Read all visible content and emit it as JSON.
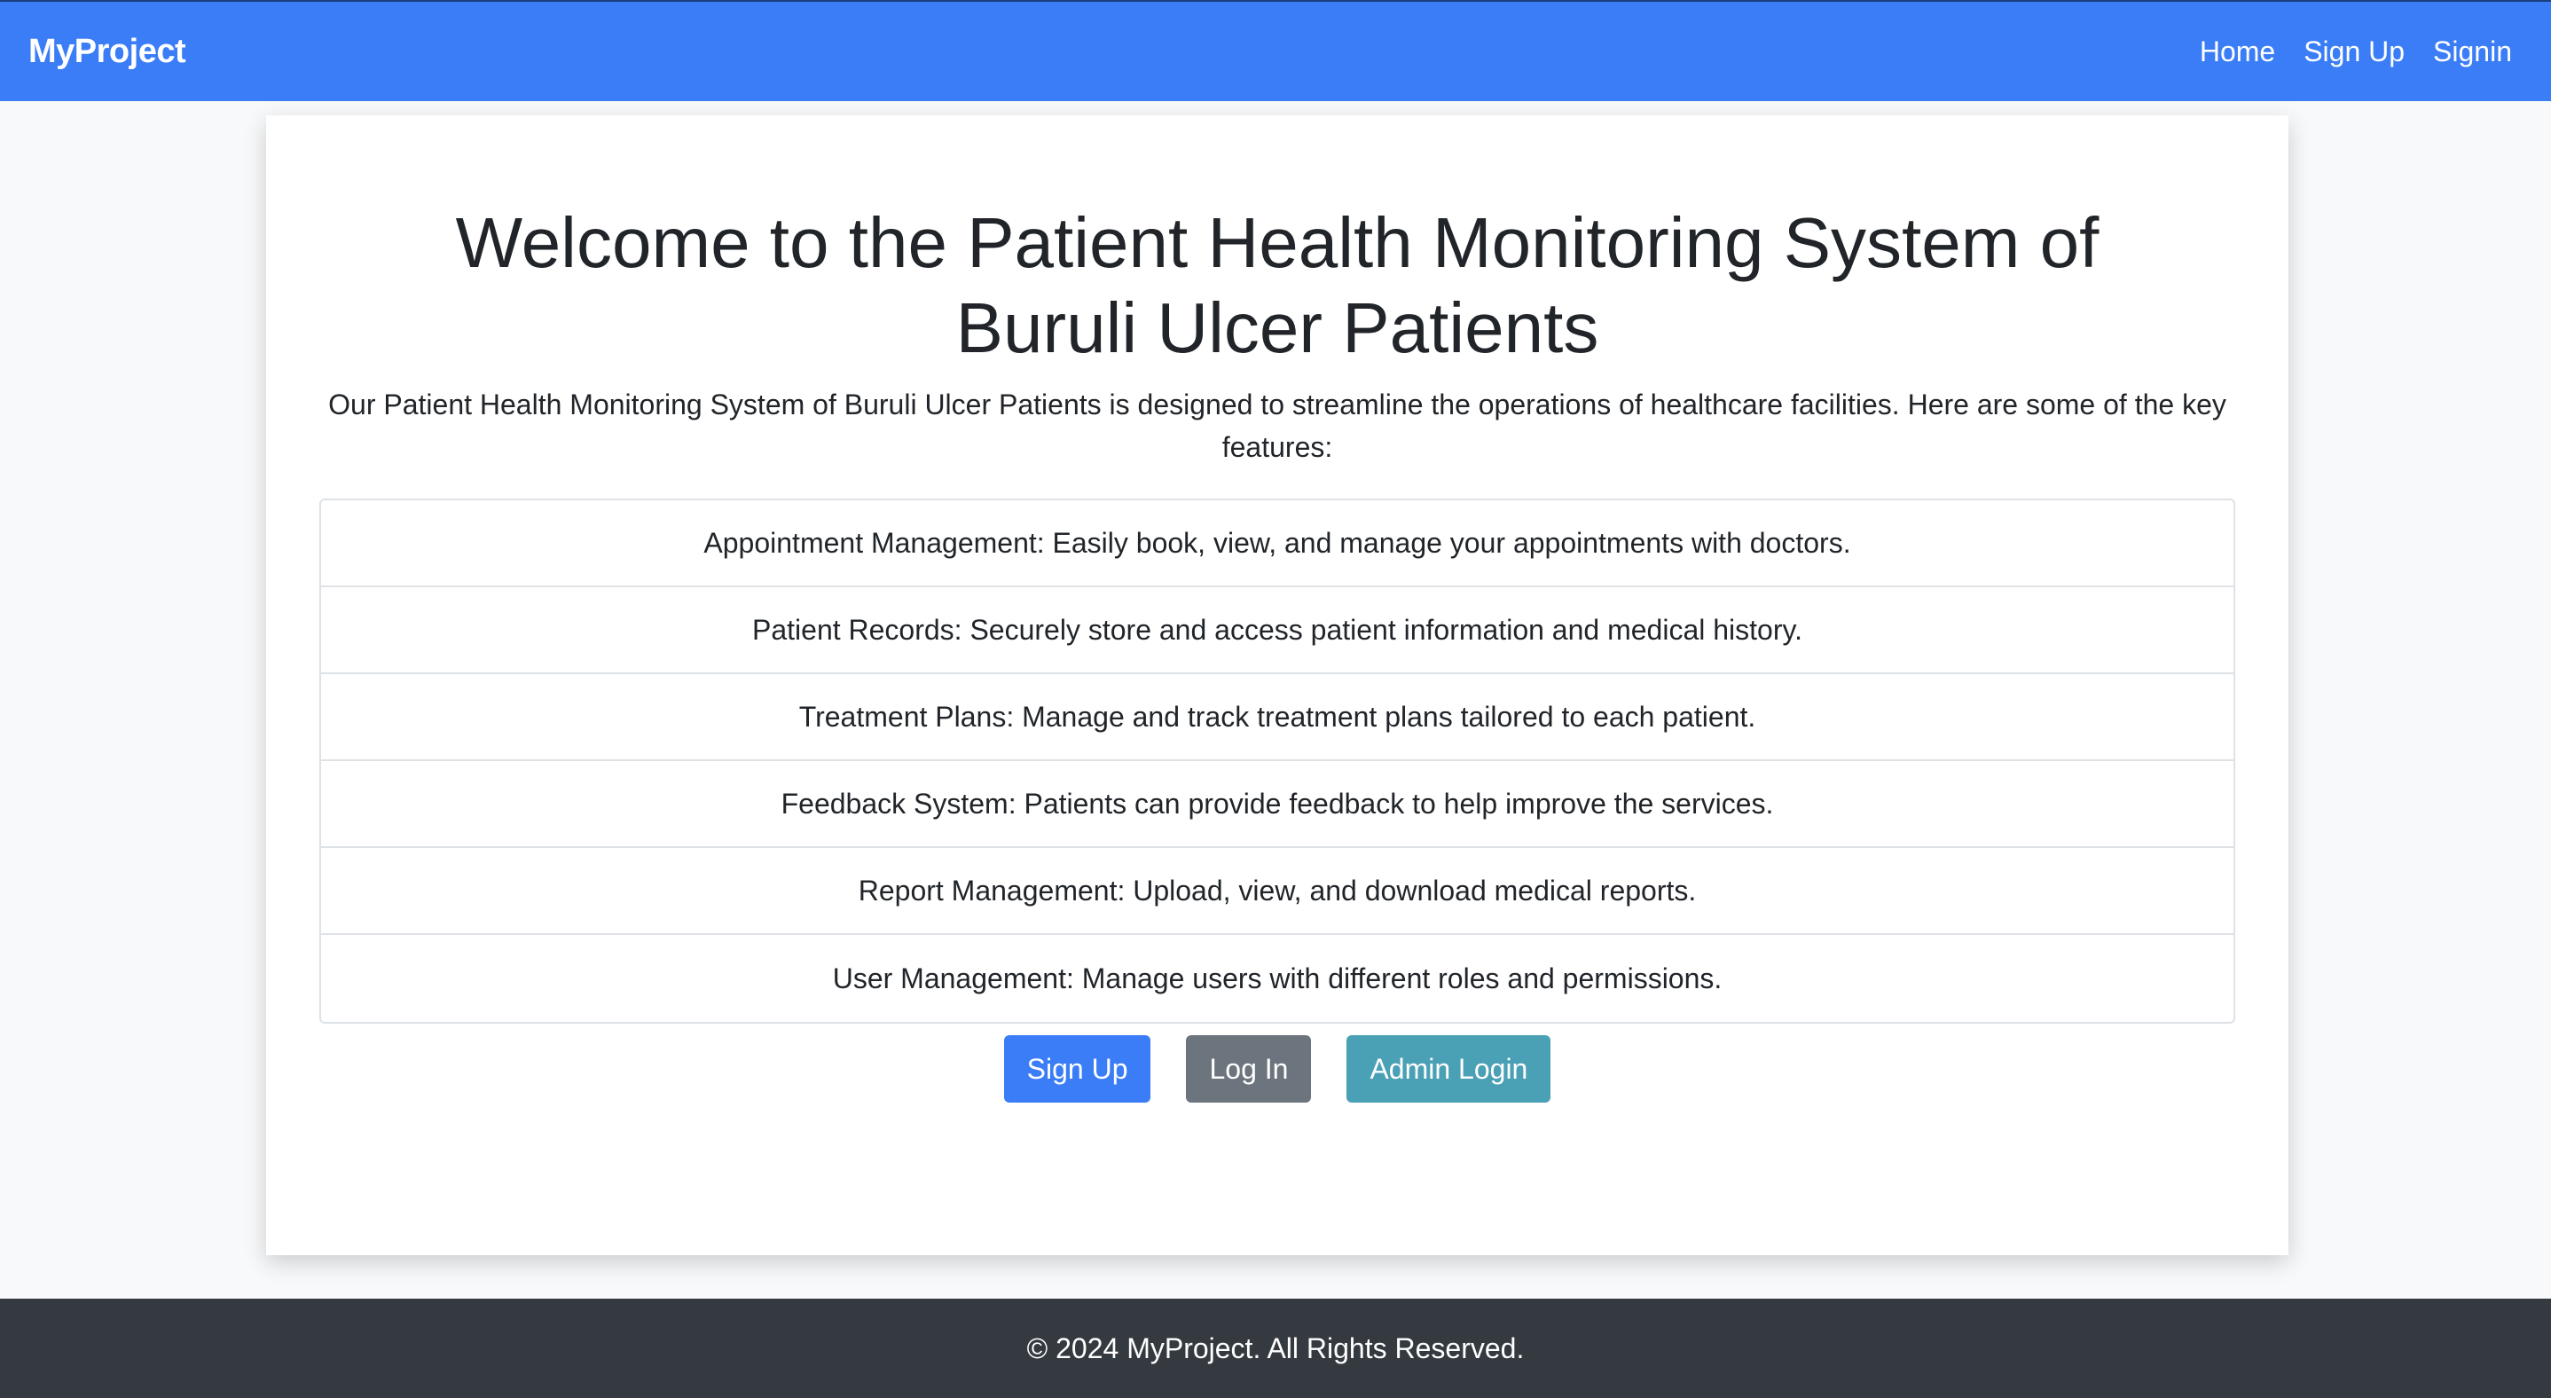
{
  "navbar": {
    "brand": "MyProject",
    "links": [
      "Home",
      "Sign Up",
      "Signin"
    ],
    "color": "#3a7df6"
  },
  "main": {
    "title": "Welcome to the Patient Health Monitoring System of Buruli Ulcer Patients",
    "intro": "Our Patient Health Monitoring System of Buruli Ulcer Patients is designed to streamline the operations of healthcare facilities. Here are some of the key features:",
    "features": [
      "Appointment Management: Easily book, view, and manage your appointments with doctors.",
      "Patient Records: Securely store and access patient information and medical history.",
      "Treatment Plans: Manage and track treatment plans tailored to each patient.",
      "Feedback System: Patients can provide feedback to help improve the services.",
      "Report Management: Upload, view, and download medical reports.",
      "User Management: Manage users with different roles and permissions."
    ],
    "buttons": {
      "signup": "Sign Up",
      "login": "Log In",
      "admin_login": "Admin Login"
    }
  },
  "footer": {
    "text": "© 2024 MyProject. All Rights Reserved.",
    "color": "#343a40"
  }
}
